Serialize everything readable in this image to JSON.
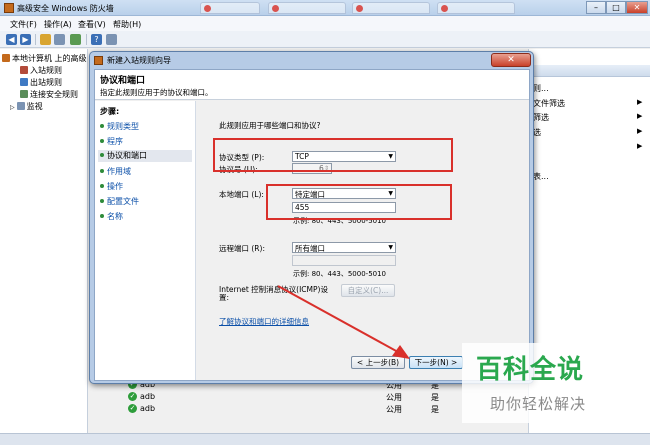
{
  "main_window": {
    "title": "高级安全 Windows 防火墙",
    "menu": [
      "文件(F)",
      "操作(A)",
      "查看(V)",
      "帮助(H)"
    ],
    "controls": {
      "minimize": "–",
      "maximize": "□",
      "close": "✕"
    }
  },
  "tree": {
    "root": "本地计算机 上的高级",
    "items": [
      "入站规则",
      "出站规则",
      "连接安全规则",
      "监视"
    ]
  },
  "actions_pane": {
    "items": [
      "则...",
      "文件筛选",
      "筛选",
      "选",
      "表..."
    ]
  },
  "rules_list": [
    {
      "name": "adb",
      "profile": "公用",
      "enabled": "是"
    },
    {
      "name": "adb",
      "profile": "公用",
      "enabled": "是"
    },
    {
      "name": "adb",
      "profile": "公用",
      "enabled": "是"
    }
  ],
  "wizard": {
    "title": "新建入站规则向导",
    "close": "✕",
    "heading": "协议和端口",
    "subtitle": "指定此规则应用于的协议和端口。",
    "steps_title": "步骤:",
    "steps": [
      "规则类型",
      "程序",
      "协议和端口",
      "作用域",
      "操作",
      "配置文件",
      "名称"
    ],
    "question": "此规则应用于哪些端口和协议?",
    "protocol_type_label": "协议类型 (P):",
    "protocol_type_value": "TCP",
    "protocol_number_label": "协议号 (U):",
    "protocol_number_value": "6",
    "local_port_label": "本地端口 (L):",
    "local_port_value": "特定端口",
    "local_port_input": "455",
    "local_port_example": "示例: 80、443、5000-5010",
    "remote_port_label": "远程端口 (R):",
    "remote_port_value": "所有端口",
    "remote_port_example": "示例: 80、443、5000-5010",
    "icmp_label_line1": "Internet 控制消息协议(ICMP)设",
    "icmp_label_line2": "置:",
    "customize_button": "自定义(C)...",
    "more_info_link": "了解协议和端口的详细信息",
    "back_button": "< 上一步(B)",
    "next_button": "下一步(N) >"
  },
  "watermark": {
    "logo": "百科全说",
    "tagline": "助你轻松解决"
  },
  "colors": {
    "highlight": "#d9302b",
    "watermark_green": "#2aa84e",
    "link_blue": "#0b4fa8"
  }
}
